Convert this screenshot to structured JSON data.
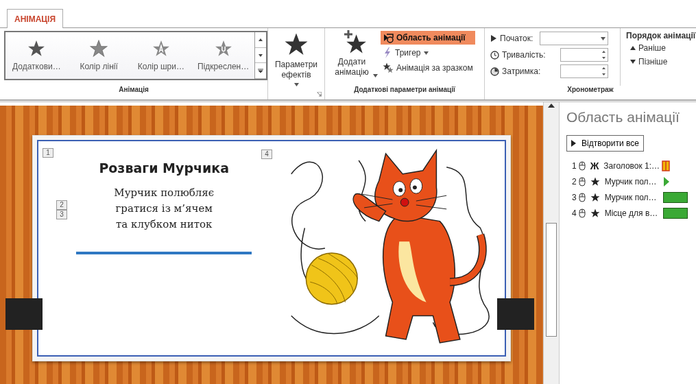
{
  "tabs": [
    {
      "label": "АНІМАЦІЯ",
      "selected": true
    }
  ],
  "animation_gallery": {
    "items": [
      {
        "label": "Додаткови…",
        "kind": "plain"
      },
      {
        "label": "Колір лінії",
        "kind": "outline"
      },
      {
        "label": "Колір шри…",
        "kind": "letter-a"
      },
      {
        "label": "Підкреслен…",
        "kind": "letter-u"
      }
    ],
    "group_label": "Анімація"
  },
  "effect_options": {
    "label": "Параметри ефектів"
  },
  "advanced": {
    "add_animation": "Додати анімацію",
    "pane_button": {
      "label": "Область анімації",
      "selected": true
    },
    "trigger": "Тригер",
    "painter": "Анімація за зразком",
    "group_label": "Додаткові параметри анімації"
  },
  "timing": {
    "fields": [
      {
        "label": "Початок:",
        "kind": "dropdown"
      },
      {
        "label": "Тривалість:",
        "kind": "spinner"
      },
      {
        "label": "Затримка:",
        "kind": "spinner"
      }
    ],
    "reorder_title": "Порядок анімації",
    "reorder": [
      {
        "label": "Раніше",
        "kind": "up"
      },
      {
        "label": "Пізніше",
        "kind": "down"
      }
    ],
    "group_label": "Хронометраж"
  },
  "slide": {
    "title": "Розваги Мурчика",
    "body": "Мурчик полюбляє\nгратися із м’ячем\nта клубком ниток",
    "tags": [
      {
        "label": "1"
      },
      {
        "label": "2"
      },
      {
        "label": "3"
      },
      {
        "label": "4"
      }
    ]
  },
  "animation_pane": {
    "title": "Область анімації",
    "play_button": "Відтворити все",
    "items": [
      {
        "number": "1",
        "kind": "glyph",
        "glyph": "Ж",
        "label": "Заголовок 1:…",
        "timing_bar": {
          "kind": "short"
        },
        "color": "#f2b705"
      },
      {
        "number": "2",
        "kind": "star",
        "label": "Мурчик пол…",
        "timing_bar": {
          "kind": "triangle"
        },
        "color": "#3aa935"
      },
      {
        "number": "3",
        "kind": "star",
        "label": "Мурчик пол…",
        "timing_bar": {
          "kind": "full"
        },
        "color": "#3aa935"
      },
      {
        "number": "4",
        "kind": "star",
        "label": "Місце для в…",
        "timing_bar": {
          "kind": "full"
        },
        "color": "#3aa935"
      }
    ]
  }
}
